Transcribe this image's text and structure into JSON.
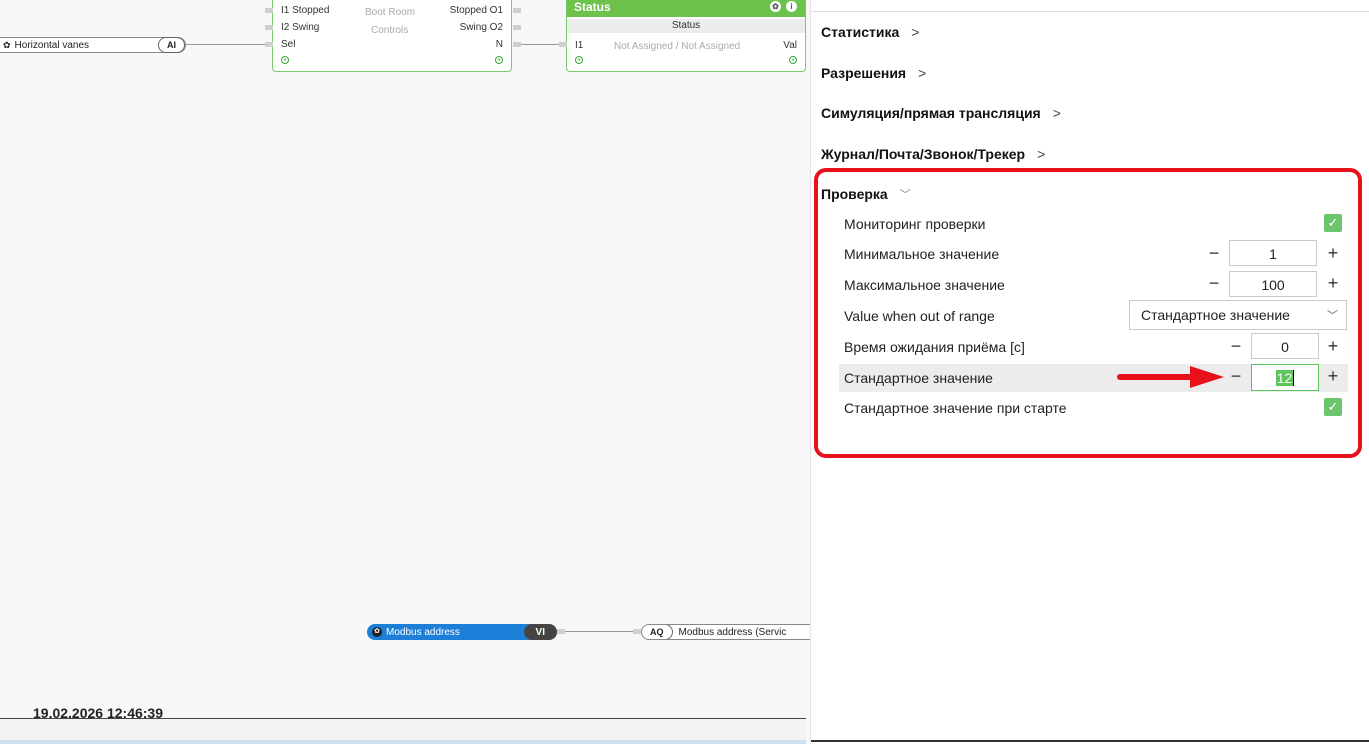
{
  "canvas": {
    "horizontal_vanes": {
      "label": "Horizontal vanes",
      "type": "AI"
    },
    "boot_block": {
      "in1": "I1 Stopped",
      "in2": "I2 Swing",
      "in3": "Sel",
      "title1": "Boot Room",
      "title2": "Controls",
      "out1": "Stopped O1",
      "out2": "Swing O2",
      "out3": "N"
    },
    "status_block": {
      "title": "Status",
      "header": "Status",
      "input": "I1",
      "value": "Not Assigned / Not Assigned",
      "output": "Val"
    },
    "modbus_vi": {
      "label": "Modbus address",
      "type": "VI"
    },
    "modbus_aq": {
      "type": "AQ",
      "label": "Modbus address (Servic"
    },
    "timestamp": "19.02.2026 12:46:39"
  },
  "panel": {
    "sections": [
      {
        "label": "Статистика",
        "expanded": false
      },
      {
        "label": "Разрешения",
        "expanded": false
      },
      {
        "label": "Симуляция/прямая трансляция",
        "expanded": false
      },
      {
        "label": "Журнал/Почта/Звонок/Трекер",
        "expanded": false
      }
    ],
    "verification": {
      "label": "Проверка",
      "monitoring_label": "Мониторинг проверки",
      "min_label": "Минимальное значение",
      "min_value": "1",
      "max_label": "Максимальное значение",
      "max_value": "100",
      "out_of_range_label": "Value when out of range",
      "out_of_range_value": "Стандартное значение",
      "timeout_label": "Время ожидания приёма [c]",
      "timeout_value": "0",
      "default_label": "Стандартное значение",
      "default_value": "12",
      "default_on_start_label": "Стандартное значение при старте",
      "stepper_minus": "−",
      "stepper_plus": "+"
    }
  },
  "colors": {
    "highlight_frame": "#e8101a",
    "check_green": "#6cc56c",
    "block_green": "#6cc24a",
    "modbus_blue": "#1e7fd8",
    "selection_green": "#5cc55c"
  }
}
